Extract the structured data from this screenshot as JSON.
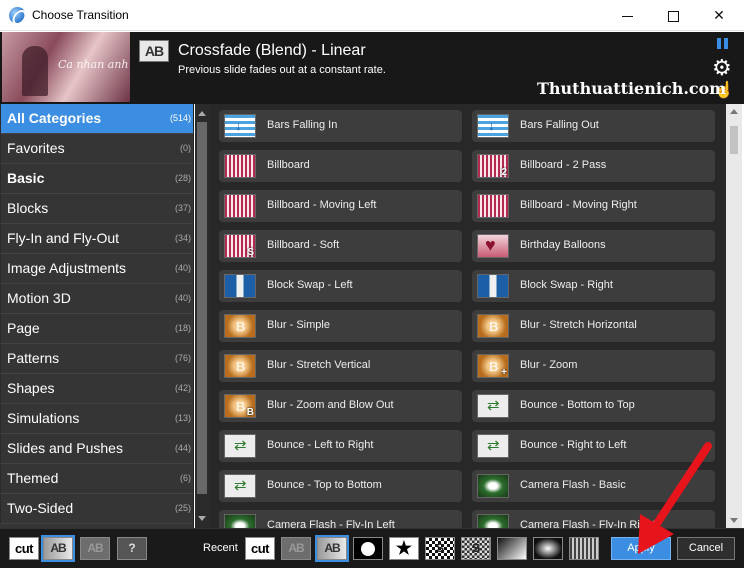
{
  "window": {
    "title": "Choose Transition",
    "minimize_label": "",
    "close_glyph": "✕"
  },
  "header": {
    "preview_script": "Ca nhan anh",
    "ab_badge": "AB",
    "transition_name": "Crossfade (Blend) - Linear",
    "transition_desc": "Previous slide fades out at a constant rate.",
    "gear_glyph": "⚙",
    "hand_glyph": "☝",
    "watermark": "Thuthuattienich.com",
    "accent_color": "#3c8ee2"
  },
  "categories": [
    {
      "label": "All Categories",
      "count": "(514)"
    },
    {
      "label": "Favorites",
      "count": "(0)"
    },
    {
      "label": "Basic",
      "count": "(28)"
    },
    {
      "label": "Blocks",
      "count": "(37)"
    },
    {
      "label": "Fly-In and Fly-Out",
      "count": "(34)"
    },
    {
      "label": "Image Adjustments",
      "count": "(40)"
    },
    {
      "label": "Motion 3D",
      "count": "(40)"
    },
    {
      "label": "Page",
      "count": "(18)"
    },
    {
      "label": "Patterns",
      "count": "(76)"
    },
    {
      "label": "Shapes",
      "count": "(42)"
    },
    {
      "label": "Simulations",
      "count": "(13)"
    },
    {
      "label": "Slides and Pushes",
      "count": "(44)"
    },
    {
      "label": "Themed",
      "count": "(6)"
    },
    {
      "label": "Two-Sided",
      "count": "(25)"
    }
  ],
  "transitions": [
    {
      "label": "Bars Falling In",
      "icon": "bars-icon",
      "sub": ""
    },
    {
      "label": "Bars Falling Out",
      "icon": "bars-icon",
      "sub": ""
    },
    {
      "label": "Billboard",
      "icon": "billboard-icon",
      "sub": ""
    },
    {
      "label": "Billboard - 2 Pass",
      "icon": "billboard-icon",
      "sub": "2"
    },
    {
      "label": "Billboard - Moving Left",
      "icon": "billboard-icon",
      "sub": ""
    },
    {
      "label": "Billboard - Moving Right",
      "icon": "billboard-icon",
      "sub": ""
    },
    {
      "label": "Billboard - Soft",
      "icon": "billboard-icon",
      "sub": "S"
    },
    {
      "label": "Birthday Balloons",
      "icon": "balloon-icon",
      "sub": ""
    },
    {
      "label": "Block Swap - Left",
      "icon": "block-swap-icon",
      "sub": ""
    },
    {
      "label": "Block Swap - Right",
      "icon": "block-swap-icon",
      "sub": ""
    },
    {
      "label": "Blur - Simple",
      "icon": "blur-icon",
      "sub": ""
    },
    {
      "label": "Blur - Stretch Horizontal",
      "icon": "blur-icon",
      "sub": ""
    },
    {
      "label": "Blur - Stretch Vertical",
      "icon": "blur-icon",
      "sub": ""
    },
    {
      "label": "Blur - Zoom",
      "icon": "blur-icon",
      "sub": "+"
    },
    {
      "label": "Blur - Zoom and Blow Out",
      "icon": "blur-icon",
      "sub": "B"
    },
    {
      "label": "Bounce - Bottom to Top",
      "icon": "bounce-icon",
      "sub": ""
    },
    {
      "label": "Bounce - Left to Right",
      "icon": "bounce-icon",
      "sub": ""
    },
    {
      "label": "Bounce - Right to Left",
      "icon": "bounce-icon",
      "sub": ""
    },
    {
      "label": "Bounce - Top to Bottom",
      "icon": "bounce-icon",
      "sub": ""
    },
    {
      "label": "Camera Flash - Basic",
      "icon": "camera-flash-icon",
      "sub": ""
    },
    {
      "label": "Camera Flash - Fly-In Left",
      "icon": "camera-flash-icon",
      "sub": ""
    },
    {
      "label": "Camera Flash - Fly-In Right",
      "icon": "camera-flash-icon",
      "sub": ""
    }
  ],
  "footer": {
    "filter_buttons": [
      "cut",
      "AB",
      "AB",
      "?"
    ],
    "recent_label": "Recent",
    "recent_buttons": [
      "cut",
      "AB",
      "AB",
      "",
      "★",
      "S",
      "S",
      "",
      "",
      ""
    ],
    "apply_label": "Apply",
    "cancel_label": "Cancel"
  }
}
